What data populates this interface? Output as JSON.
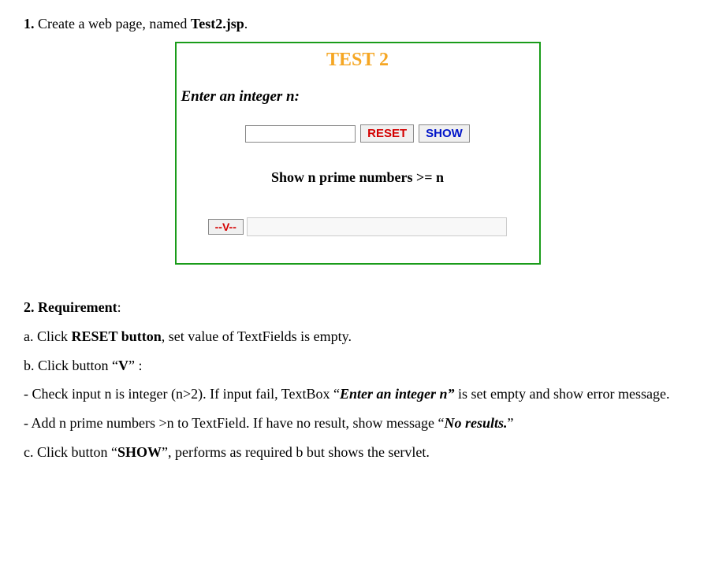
{
  "line1": {
    "num": "1. ",
    "text_a": "Create a web page, named ",
    "bold": "Test2.jsp",
    "text_b": "."
  },
  "form": {
    "title": "TEST 2",
    "prompt": "Enter an integer n:",
    "input_value": "",
    "reset_label": "RESET",
    "show_label": "SHOW",
    "subhead": "Show n prime numbers >= n",
    "v_label": "--V--",
    "result_value": ""
  },
  "req": {
    "heading_num": "2. ",
    "heading_bold": "Requirement",
    "heading_colon": ":",
    "a_pre": "a. Click ",
    "a_bold": "RESET button",
    "a_post": ", set value of TextFields is empty.",
    "b_pre": "b. Click button “",
    "b_bold": "V",
    "b_post": "” :",
    "b1_pre": "- Check input n is integer (n>2). If input fail, TextBox “",
    "b1_ital": "Enter an integer n” ",
    "b1_post": "is set empty and show error message.",
    "b2_pre": "- Add n prime numbers >n to TextField. If have no result, show message “",
    "b2_ital": "No results.",
    "b2_post": "”",
    "c_pre": "c. Click button “",
    "c_bold": "SHOW",
    "c_post": "”, performs as required b but shows the servlet."
  }
}
